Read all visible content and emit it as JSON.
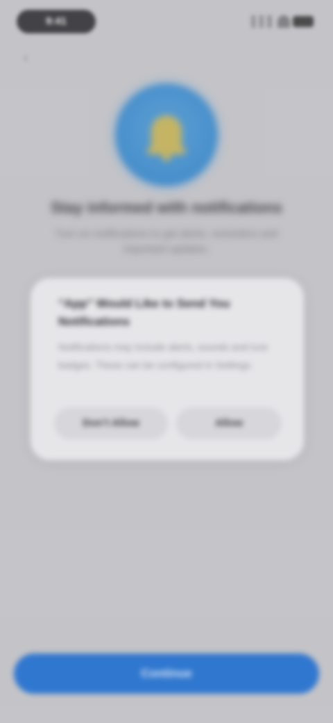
{
  "status_bar": {
    "time": "9:41"
  },
  "onboarding": {
    "title": "Stay informed with notifications",
    "description": "Turn on notifications to get alerts, reminders and important updates."
  },
  "alert": {
    "title": "“App” Would Like to Send You Notifications",
    "message": "Notifications may include alerts, sounds and icon badges. These can be configured in Settings.",
    "deny_label": "Don’t Allow",
    "allow_label": "Allow"
  },
  "primary_button": {
    "label": "Continue"
  },
  "icons": {
    "hero": "bell-icon",
    "back": "chevron-left-icon"
  },
  "colors": {
    "accent": "#3077cf",
    "hero_circle": "#2f86cf",
    "bell": "#c8b451",
    "background": "#c7c7cb",
    "alert_background": "#e6e6e9"
  }
}
